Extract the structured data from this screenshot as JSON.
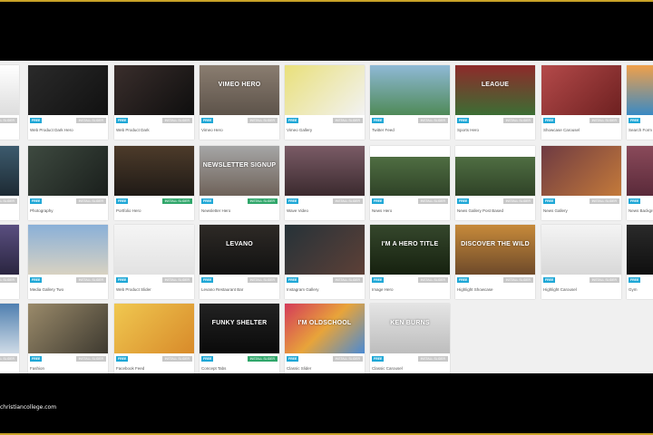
{
  "watermark": "christiancollege.com",
  "colors": {
    "frame": "#000000",
    "accent_line": "#c9a227",
    "badge_blue": "#1ea7d6",
    "install_grey": "#c8c8c8",
    "install_green": "#2fa66a"
  },
  "badge_label": "FREE",
  "install_label": "INSTALL SLIDER",
  "rows": [
    [
      {
        "name": "",
        "overlay": "",
        "bg": "linear-gradient(#ffffff,#dddddd)",
        "installed": false
      },
      {
        "name": "Web Product Dark Hero",
        "overlay": "",
        "bg": "linear-gradient(135deg,#2a2a2a,#111111)",
        "installed": false
      },
      {
        "name": "Web Product Dark",
        "overlay": "",
        "bg": "linear-gradient(135deg,#3a2e2c,#0e0e0e)",
        "installed": false
      },
      {
        "name": "Vimeo Hero",
        "overlay": "VIMEO HERO",
        "bg": "linear-gradient(#8a7d70,#5d534a)",
        "installed": false
      },
      {
        "name": "Vimeo Gallery",
        "overlay": "",
        "bg": "linear-gradient(135deg,#e9e07a,#f2f2f2)",
        "installed": false
      },
      {
        "name": "Twitter Feed",
        "overlay": "",
        "bg": "linear-gradient(#8fb9d6,#4f8a58)",
        "installed": false
      },
      {
        "name": "Sports Hero",
        "overlay": "LEAGUE",
        "bg": "linear-gradient(#8e2a2a,#3c6e34)",
        "installed": false
      },
      {
        "name": "Showcase Carousel",
        "overlay": "",
        "bg": "linear-gradient(135deg,#b44a4a,#6d2020)",
        "installed": false
      },
      {
        "name": "Search Form Hero",
        "overlay": "",
        "bg": "linear-gradient(#f0a04a,#3a8ac4)",
        "installed": false
      }
    ],
    [
      {
        "name": "",
        "overlay": "",
        "bg": "linear-gradient(#3d5b6e,#1d2a33)",
        "installed": false
      },
      {
        "name": "Photography",
        "overlay": "",
        "bg": "linear-gradient(135deg,#3e4a40,#1a1f1c)",
        "installed": false
      },
      {
        "name": "Portfolio Hero",
        "overlay": "",
        "bg": "linear-gradient(#4d3b2a,#1f1a16)",
        "installed": true
      },
      {
        "name": "Newsletter Hero",
        "overlay": "NEWSLETTER SIGNUP",
        "bg": "linear-gradient(#a6a6a6,#6e6259)",
        "installed": true
      },
      {
        "name": "Wave Video",
        "overlay": "",
        "bg": "linear-gradient(#7a5b66,#3b2a2e)",
        "installed": false
      },
      {
        "name": "News Hero",
        "overlay": "",
        "bg": "linear-gradient(#ffffff 22%,#4f6e42 22%,#2f4227)",
        "installed": false
      },
      {
        "name": "News Gallery Post Based",
        "overlay": "",
        "bg": "linear-gradient(#ffffff 22%,#4f6e42 22%,#2f4227)",
        "installed": false
      },
      {
        "name": "News Gallery",
        "overlay": "",
        "bg": "linear-gradient(135deg,#6e3a42,#c47a3a)",
        "installed": false
      },
      {
        "name": "News Background Video",
        "overlay": "",
        "bg": "linear-gradient(#8a4a5a,#5a2a3a)",
        "installed": false
      }
    ],
    [
      {
        "name": "",
        "overlay": "",
        "bg": "linear-gradient(#5a4f80,#2a2540)",
        "installed": false
      },
      {
        "name": "Media Gallery Two",
        "overlay": "",
        "bg": "linear-gradient(#8ab0d8,#d8d2c2)",
        "installed": false
      },
      {
        "name": "Web Product Slider",
        "overlay": "",
        "bg": "linear-gradient(#f5f5f5,#e2e2e2)",
        "installed": false
      },
      {
        "name": "Levano Restaurant Bar",
        "overlay": "LEVANO",
        "bg": "linear-gradient(#2e2a26,#111111)",
        "installed": false
      },
      {
        "name": "Instagram Gallery",
        "overlay": "",
        "bg": "linear-gradient(135deg,#263238,#5d4037)",
        "installed": false
      },
      {
        "name": "Image Hero",
        "overlay": "I'M A HERO TITLE",
        "bg": "linear-gradient(#35472c,#16210f)",
        "installed": false
      },
      {
        "name": "Highlight Showcase",
        "overlay": "DISCOVER THE WILD",
        "bg": "linear-gradient(#c78a3a,#6e4a2a)",
        "installed": false
      },
      {
        "name": "Highlight Carousel",
        "overlay": "",
        "bg": "linear-gradient(#f4f4f4,#d8d8d8)",
        "installed": false
      },
      {
        "name": "Gym",
        "overlay": "",
        "bg": "linear-gradient(#2a2a2a,#0f0f0f)",
        "installed": false
      }
    ],
    [
      {
        "name": "",
        "overlay": "",
        "bg": "linear-gradient(#4f7fb0,#cfdbe6)",
        "installed": false
      },
      {
        "name": "Fashion",
        "overlay": "",
        "bg": "linear-gradient(135deg,#9a8a6a,#3e3a30)",
        "installed": false
      },
      {
        "name": "Facebook Feed",
        "overlay": "",
        "bg": "linear-gradient(135deg,#f0c850,#d88a2a)",
        "installed": false
      },
      {
        "name": "Concept Tabs",
        "overlay": "FUNKY SHELTER",
        "bg": "linear-gradient(#222222,#0a0a0a)",
        "installed": true
      },
      {
        "name": "Classic Slider",
        "overlay": "I'M OLDSCHOOL",
        "bg": "linear-gradient(135deg,#d43a5a,#e8a43a,#4a8ad4)",
        "installed": false
      },
      {
        "name": "Classic Carousel",
        "overlay": "KEN BURNS",
        "bg": "linear-gradient(#e4e4e4,#bdbdbd)",
        "installed": false
      }
    ]
  ]
}
